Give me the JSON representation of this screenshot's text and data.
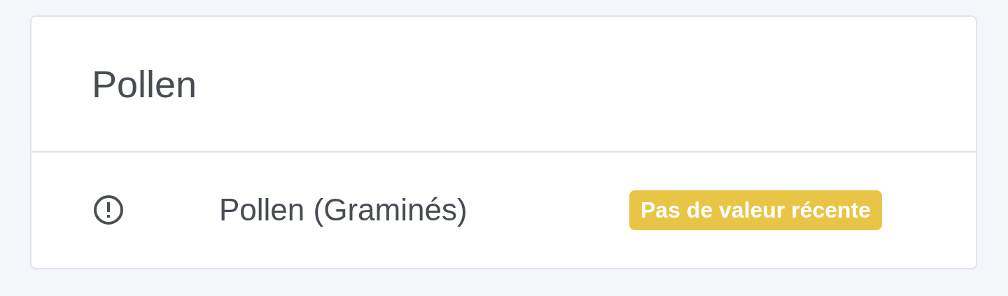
{
  "card": {
    "title": "Pollen",
    "rows": [
      {
        "kind": "alert",
        "name": "Pollen (Graminés)",
        "badge": "Pas de valeur récente",
        "color": "#e8c547"
      }
    ]
  }
}
